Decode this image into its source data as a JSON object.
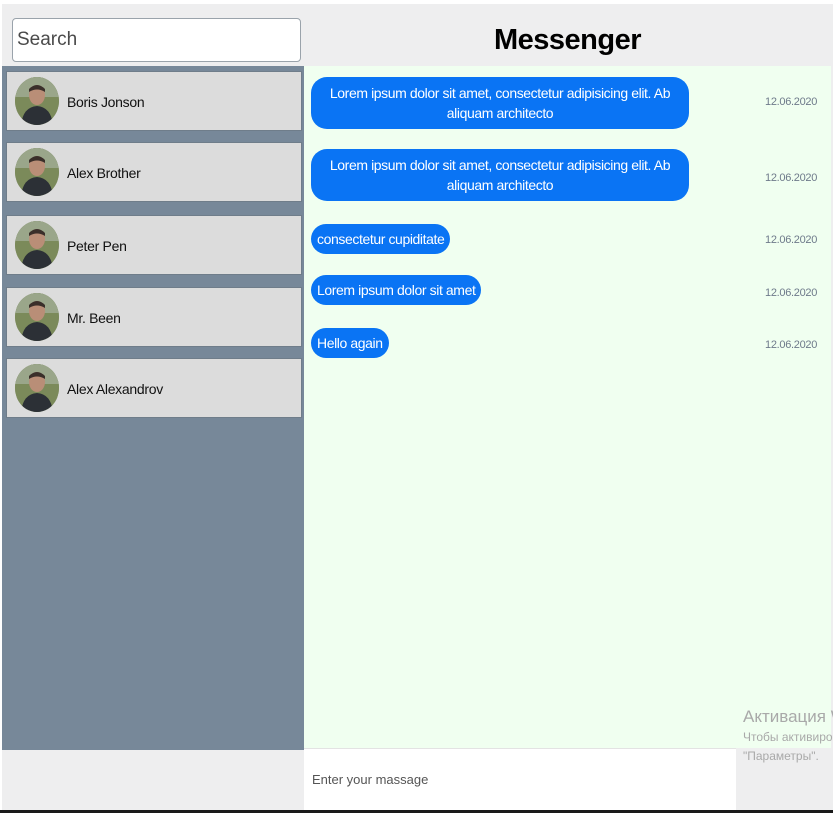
{
  "search": {
    "placeholder": "Search"
  },
  "header": {
    "title": "Messenger"
  },
  "contacts": [
    {
      "name": "Boris Jonson"
    },
    {
      "name": "Alex Brother"
    },
    {
      "name": "Peter Pen"
    },
    {
      "name": "Mr. Been"
    },
    {
      "name": "Alex Alexandrov"
    }
  ],
  "messages": [
    {
      "text": "Lorem ipsum dolor sit amet, consectetur adipisicing elit. Ab aliquam architecto",
      "time": "12.06.2020"
    },
    {
      "text": "Lorem ipsum dolor sit amet, consectetur adipisicing elit. Ab aliquam architecto",
      "time": "12.06.2020"
    },
    {
      "text": "consectetur cupiditate",
      "time": "12.06.2020"
    },
    {
      "text": "Lorem ipsum dolor sit amet",
      "time": "12.06.2020"
    },
    {
      "text": "Hello again",
      "time": "12.06.2020"
    }
  ],
  "composer": {
    "placeholder": "Enter your massage"
  },
  "watermark": {
    "title": "Активация Windows",
    "line1": "Чтобы активировать Windows, перейдите в раздел",
    "line2": "\"Параметры\"."
  },
  "colors": {
    "sidebar_bg": "#778899",
    "chat_bg": "#f0fff0",
    "bubble": "#0a74f4",
    "contact_bg": "#dcdcdc"
  }
}
